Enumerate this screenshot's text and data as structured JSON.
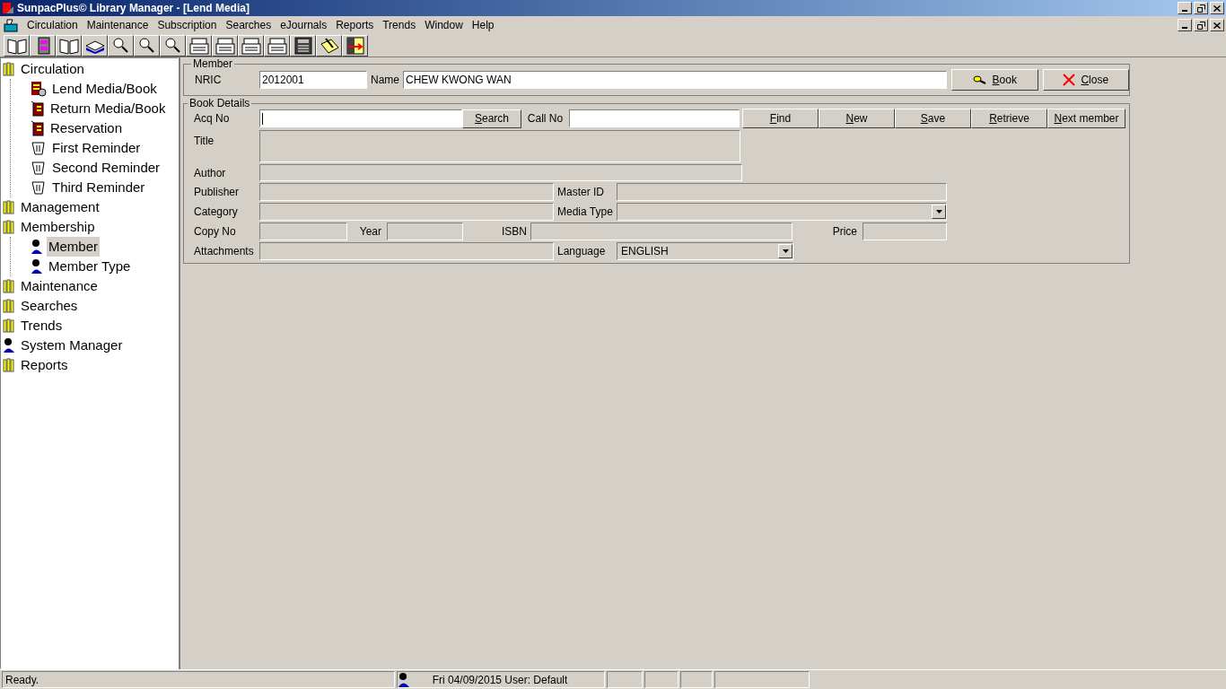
{
  "window": {
    "title": "SunpacPlus© Library Manager - [Lend Media]"
  },
  "menu": [
    "Circulation",
    "Maintenance",
    "Subscription",
    "Searches",
    "eJournals",
    "Reports",
    "Trends",
    "Window",
    "Help"
  ],
  "toolbar": [
    {
      "kind": "book"
    },
    {
      "kind": "cabinet"
    },
    {
      "kind": "book"
    },
    {
      "kind": "stack"
    },
    {
      "kind": "search"
    },
    {
      "kind": "search"
    },
    {
      "kind": "search"
    },
    {
      "kind": "printer"
    },
    {
      "kind": "printer"
    },
    {
      "kind": "printer"
    },
    {
      "kind": "printer"
    },
    {
      "kind": "calculator"
    },
    {
      "kind": "notepad"
    },
    {
      "kind": "exit"
    }
  ],
  "sidebar": {
    "tree": [
      {
        "label": "Circulation",
        "kind": "folder",
        "selected": false,
        "children": [
          {
            "label": "Lend Media/Book",
            "kind": "lend",
            "selected": false
          },
          {
            "label": "Return Media/Book",
            "kind": "book",
            "selected": false
          },
          {
            "label": "Reservation",
            "kind": "book",
            "selected": false
          },
          {
            "label": "First Reminder",
            "kind": "reminder",
            "selected": false
          },
          {
            "label": "Second Reminder",
            "kind": "reminder",
            "selected": false
          },
          {
            "label": "Third Reminder",
            "kind": "reminder",
            "selected": false
          }
        ]
      },
      {
        "label": "Management",
        "kind": "folder",
        "selected": false
      },
      {
        "label": "Membership",
        "kind": "folder",
        "selected": false,
        "children": [
          {
            "label": "Member",
            "kind": "person",
            "selected": true
          },
          {
            "label": "Member Type",
            "kind": "person",
            "selected": false
          }
        ]
      },
      {
        "label": "Maintenance",
        "kind": "folder",
        "selected": false
      },
      {
        "label": "Searches",
        "kind": "folder",
        "selected": false
      },
      {
        "label": "Trends",
        "kind": "folder",
        "selected": false
      },
      {
        "label": "System Manager",
        "kind": "person",
        "selected": false
      },
      {
        "label": "Reports",
        "kind": "folder",
        "selected": false
      }
    ]
  },
  "member": {
    "legend": "Member",
    "nric_label": "NRIC",
    "nric_value": "2012001",
    "name_label": "Name",
    "name_value": "CHEW KWONG WAN",
    "buttons": [
      {
        "label": "Book",
        "kind": "search"
      },
      {
        "label": "Close",
        "kind": "close"
      }
    ]
  },
  "book_details": {
    "legend": "Book Details",
    "acq_no_label": "Acq No",
    "search_button": "Search",
    "call_no_label": "Call No",
    "actions": [
      "Find",
      "New",
      "Save",
      "Retrieve",
      "Next member"
    ],
    "title_label": "Title",
    "author_label": "Author",
    "publisher_label": "Publisher",
    "master_id_label": "Master ID",
    "category_label": "Category",
    "media_type_label": "Media Type",
    "copy_no_label": "Copy No",
    "year_label": "Year",
    "isbn_label": "ISBN",
    "price_label": "Price",
    "attachments_label": "Attachments",
    "language_label": "Language",
    "language_value": "ENGLISH"
  },
  "status_bar": {
    "message": "Ready.",
    "user_info": "Fri 04/09/2015 User: Default"
  }
}
